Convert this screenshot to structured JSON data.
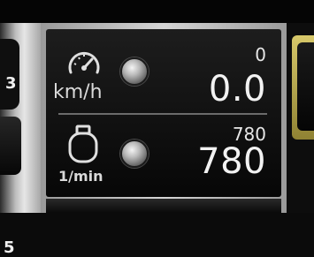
{
  "speed": {
    "icon": "speedometer-icon",
    "unit": "km/h",
    "setpoint": "0",
    "value": "0.0"
  },
  "engine": {
    "icon": "engine-icon",
    "unit": "1/min",
    "setpoint": "780",
    "value": "780"
  }
}
